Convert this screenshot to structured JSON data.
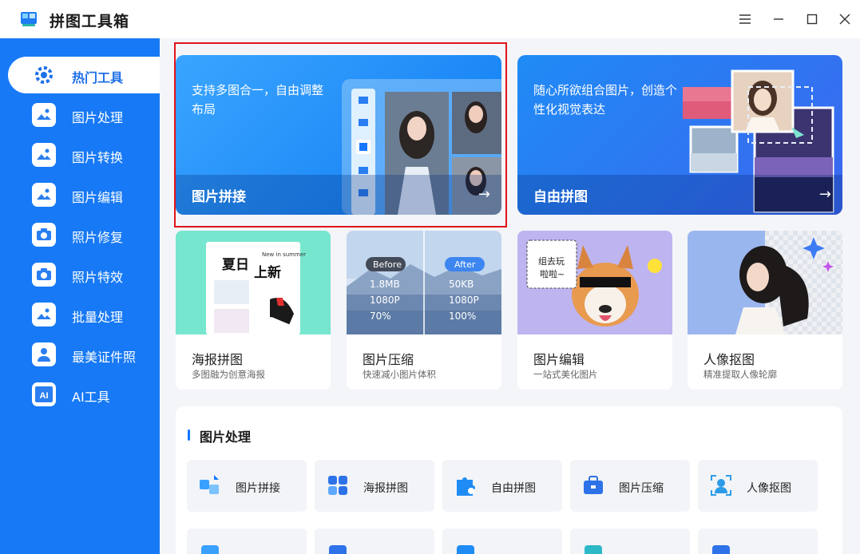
{
  "app": {
    "title": "拼图工具箱"
  },
  "sidebar": {
    "items": [
      {
        "label": "热门工具",
        "icon": "gear-icon",
        "active": true
      },
      {
        "label": "图片处理",
        "icon": "image-process-icon"
      },
      {
        "label": "图片转换",
        "icon": "image-convert-icon"
      },
      {
        "label": "图片编辑",
        "icon": "image-edit-icon"
      },
      {
        "label": "照片修复",
        "icon": "camera-repair-icon"
      },
      {
        "label": "照片特效",
        "icon": "camera-effect-icon"
      },
      {
        "label": "批量处理",
        "icon": "batch-icon"
      },
      {
        "label": "最美证件照",
        "icon": "id-photo-icon"
      },
      {
        "label": "AI工具",
        "icon": "ai-icon"
      }
    ]
  },
  "hero": [
    {
      "desc": "支持多图合一，自由调整布局",
      "title": "图片拼接",
      "arrow": "→"
    },
    {
      "desc": "随心所欲组合图片，创造个性化视觉表达",
      "title": "自由拼图",
      "arrow": "→"
    }
  ],
  "cards": [
    {
      "title": "海报拼图",
      "sub": "多图融为创意海报",
      "poster_text": "夏日",
      "poster_text2": "上新",
      "poster_small": "New in summer"
    },
    {
      "title": "图片压缩",
      "sub": "快速减小图片体积",
      "before_label": "Before",
      "after_label": "After",
      "before_values": [
        "1.8MB",
        "1080P",
        "70%"
      ],
      "after_values": [
        "50KB",
        "1080P",
        "100%"
      ]
    },
    {
      "title": "图片编辑",
      "sub": "一站式美化图片",
      "bubble_text": "组去玩",
      "bubble_text2": "啦啦~"
    },
    {
      "title": "人像抠图",
      "sub": "精准提取人像轮廓"
    }
  ],
  "section": {
    "title": "图片处理",
    "tools": [
      {
        "label": "图片拼接",
        "icon": "puzzle-join-icon"
      },
      {
        "label": "海报拼图",
        "icon": "poster-grid-icon"
      },
      {
        "label": "自由拼图",
        "icon": "free-puzzle-icon"
      },
      {
        "label": "图片压缩",
        "icon": "compress-box-icon"
      },
      {
        "label": "人像抠图",
        "icon": "portrait-cutout-icon"
      },
      {
        "label": "",
        "icon": "tool-icon"
      },
      {
        "label": "",
        "icon": "tool-icon"
      },
      {
        "label": "",
        "icon": "tool-icon"
      },
      {
        "label": "",
        "icon": "tool-icon"
      },
      {
        "label": "",
        "icon": "tool-icon"
      }
    ]
  },
  "colors": {
    "accent": "#1779f5",
    "highlight": "#e0141a"
  }
}
